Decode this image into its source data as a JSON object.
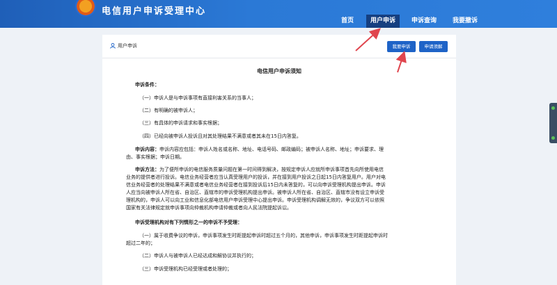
{
  "header": {
    "site_title": "电信用户申诉受理中心",
    "nav": [
      "首页",
      "用户申诉",
      "申诉查询",
      "我要撤诉"
    ]
  },
  "panel": {
    "title": "用户申诉",
    "btn_complain": "我要申诉",
    "btn_guide": "申请须解",
    "notice_title": "电信用户申诉须知",
    "lines": [
      {
        "strong": "申诉条件：",
        "text": ""
      },
      {
        "strong": "",
        "text": "（一）申诉人是与申诉事项有直接利害关系的当事人；"
      },
      {
        "strong": "",
        "text": "（二）有明确的被申诉人；"
      },
      {
        "strong": "",
        "text": "（三）有具体的申诉请求和事实根据；"
      },
      {
        "strong": "",
        "text": "（四）已经向被申诉人投诉且对其处理结果不满意或者其未在15日内答复。"
      },
      {
        "strong": "申诉内容：",
        "text": "申诉内容应包括：申诉人姓名或名称、地址、电话号码、邮政编码；被申诉人名称、地址；申诉要求、理"
      },
      {
        "strong": "",
        "text": "由、事实根据；申诉日期。"
      },
      {
        "strong": "申诉方法：",
        "text": "为了便所申诉的电信服务质量问题在第一时间得到解决，按规定申诉人应就所申诉事项首先向所使用电信"
      },
      {
        "strong": "",
        "text": "业务的提供者进行投诉。电信业务经营者应当认真受理用户的投诉，并在接到用户投诉之日起15日内答复用户。用户对电"
      },
      {
        "strong": "",
        "text": "信业务经营者的处理结果不满意或者电信业务经营者在接到投诉后15日内未答复的，可以向申诉受理机构提出申诉。申诉"
      },
      {
        "strong": "",
        "text": "人应当向被申诉人所在省、自治区、直辖市的申诉受理机构提出申诉。被申诉人所在省、自治区、直辖市没有设立申诉受"
      },
      {
        "strong": "",
        "text": "理机构的，申诉人可以向工业和信息化部电信用户申诉受理中心提出申诉。申诉受理机构调解无效的，争议双方可以依照"
      },
      {
        "strong": "",
        "text": "国家有关法律规定就申诉事项向仲裁机构申请仲裁或者向人民法院提起诉讼。"
      },
      {
        "strong": "申诉受理机构对有下列情形之一的申诉不予受理：",
        "text": ""
      },
      {
        "strong": "",
        "text": "（一）属于收费争议的申诉，申诉事项发生时距提起申诉时超过五个月的，其他申诉，申诉事项发生时距提起申诉时"
      },
      {
        "strong": "",
        "text": "超过二年的；"
      },
      {
        "strong": "",
        "text": "（二）申诉人与被申诉人已经达成和解协议并执行的；"
      },
      {
        "strong": "",
        "text": "（三）申诉受理机构已经受理或者处理的；"
      }
    ]
  },
  "colors": {
    "header": "#2b79d6",
    "nav_active": "#153f80",
    "button": "#1e63c7",
    "arrow": "#e0454e"
  }
}
